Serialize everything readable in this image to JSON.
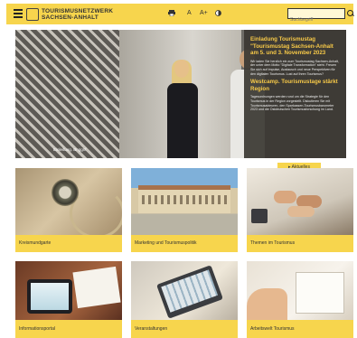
{
  "header": {
    "logo_line1": "TOURISMUSNETZWERK",
    "logo_line2": "SACHSEN-ANHALT",
    "tools": {
      "print_icon": "printer-icon",
      "font_small": "A",
      "font_large": "A+",
      "contrast_icon": "contrast-icon"
    },
    "search": {
      "placeholder": "Suchbegriff"
    }
  },
  "hero": {
    "caption": "Einleitung. Bnggnf",
    "heading1": "Einladung Tourismustag \"Tourismustag Sachsen-Anhalt am 5. und 3. November 2023",
    "text1": "Wir laden Sie herzlich ein zum Tourismustag Sachsen-Anhalt, der unter dem Motto \"Digitale Transformation\" steht. Freuen Sie sich auf Impulse, Austausch und neue Perspektiven für den digitalen Tourismus. Lust auf Ihren Tourismus?",
    "heading2": "Westcamp. Tourismustage stärkt Region",
    "text2": "Tagesordnungen werden rund um die Strategie für den Tourismus in der Region vorgestellt. Diskutieren Sie mit Tourismusakteuren, den Sparkassen-Tourismusbarometer 2023 und die Ostdeutschen Tourismusforschung im Land."
  },
  "aktuelles": "Aktuelles",
  "tiles": [
    {
      "label": "Kreismundgarte"
    },
    {
      "label": "Marketing und Tourismuspolitik"
    },
    {
      "label": "Themen im Tourismus"
    },
    {
      "label": "Informationsportal"
    },
    {
      "label": "Veranstaltungen"
    },
    {
      "label": "Arbeitswelt Tourismus"
    }
  ],
  "colors": {
    "accent": "#f7d54d",
    "hero_heading": "#f7c948",
    "hero_panel": "#3a3732"
  }
}
